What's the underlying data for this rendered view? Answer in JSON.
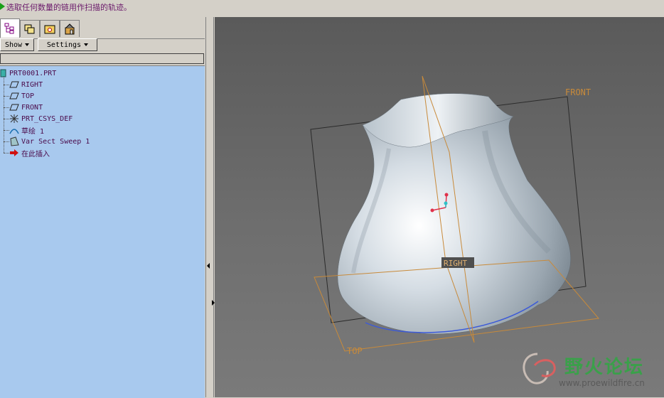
{
  "message": {
    "text": "选取任何数量的链用作扫描的轨迹。"
  },
  "model_tree": {
    "tabs": [
      "model-tree-tab",
      "layers-tab",
      "folder-tab",
      "favorites-tab"
    ],
    "show_label": "Show",
    "settings_label": "Settings",
    "items": [
      {
        "label": "PRT0001.PRT",
        "icon": "part-icon"
      },
      {
        "label": "RIGHT",
        "icon": "datum-plane-icon"
      },
      {
        "label": "TOP",
        "icon": "datum-plane-icon"
      },
      {
        "label": "FRONT",
        "icon": "datum-plane-icon"
      },
      {
        "label": "PRT_CSYS_DEF",
        "icon": "coordinate-system-icon"
      },
      {
        "label": "草绘 1",
        "icon": "sketch-icon"
      },
      {
        "label": "Var Sect Sweep 1",
        "icon": "sweep-icon"
      },
      {
        "label": "在此插入",
        "icon": "insert-here-arrow-icon"
      }
    ]
  },
  "viewport": {
    "datum_labels": {
      "front": "FRONT",
      "right": "RIGHT",
      "top": "TOP"
    },
    "colors": {
      "datum": "#c88a3a",
      "background": "#6a6a6a",
      "surface": "#c9d3dc"
    }
  },
  "watermark": {
    "title": "野火论坛",
    "url": "www.proewildfire.cn"
  }
}
